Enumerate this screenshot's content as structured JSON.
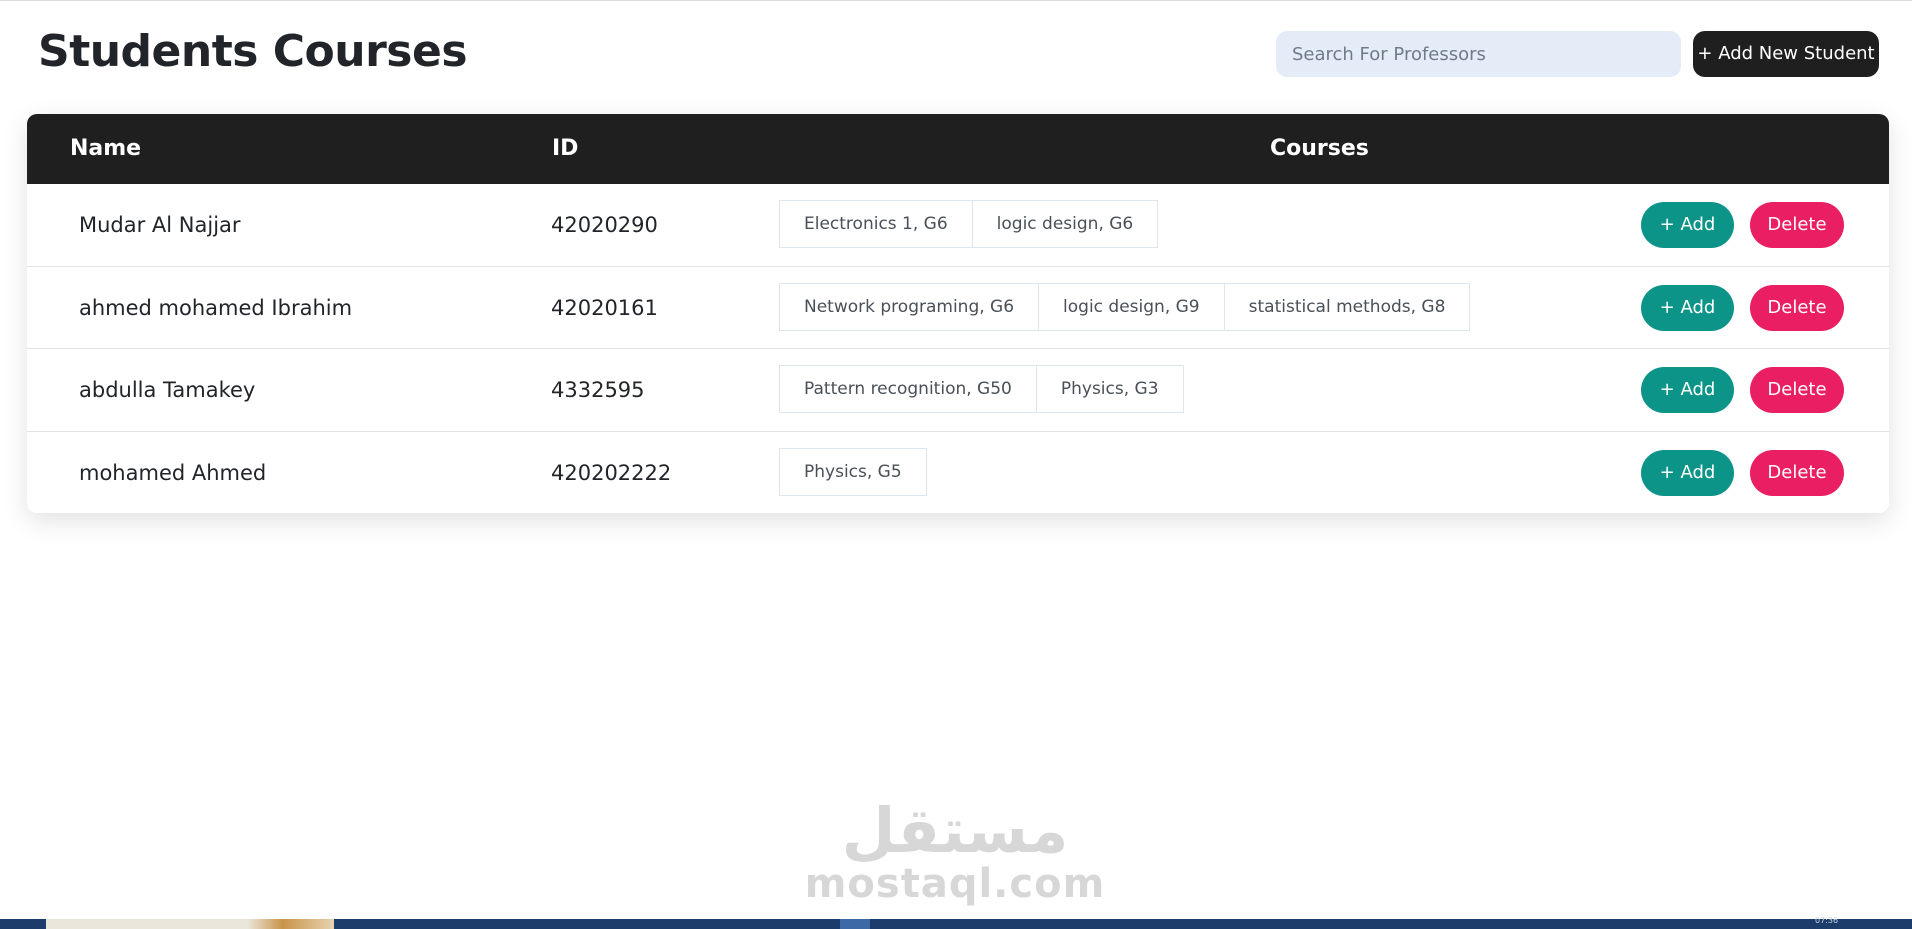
{
  "header": {
    "title": "Students Courses",
    "search_placeholder": "Search For Professors",
    "add_student_label": "+ Add New Student"
  },
  "table": {
    "columns": {
      "name": "Name",
      "id": "ID",
      "courses": "Courses"
    },
    "rows": [
      {
        "name": "Mudar Al Najjar",
        "id": "42020290",
        "courses": [
          "Electronics 1, G6",
          "logic design, G6"
        ]
      },
      {
        "name": "ahmed mohamed Ibrahim",
        "id": "42020161",
        "courses": [
          "Network programing, G6",
          "logic design, G9",
          "statistical methods, G8"
        ]
      },
      {
        "name": "abdulla Tamakey",
        "id": "4332595",
        "courses": [
          "Pattern recognition, G50",
          "Physics, G3"
        ]
      },
      {
        "name": "mohamed Ahmed",
        "id": "420202222",
        "courses": [
          "Physics, G5"
        ]
      }
    ],
    "add_label": "+ Add",
    "delete_label": "Delete"
  },
  "watermark": {
    "arabic": "مستقل",
    "latin": "mostaql.com"
  },
  "taskbar": {
    "clock": "07:36"
  },
  "colors": {
    "header_bg": "#1f1f1f",
    "add_button": "#0d9488",
    "delete_button": "#e91e63",
    "search_bg": "#e3ecf7"
  }
}
